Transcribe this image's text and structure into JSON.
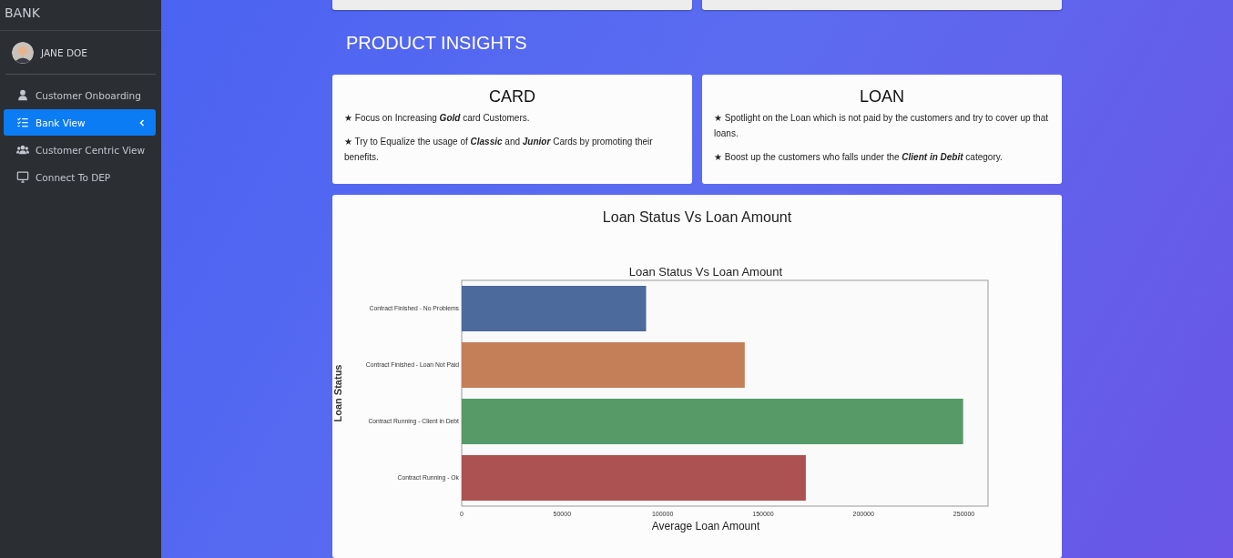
{
  "sidebar": {
    "brand": "BANK",
    "user": {
      "name": "JANE DOE"
    },
    "items": [
      {
        "label": "Customer Onboarding",
        "selected": false,
        "expandable": false
      },
      {
        "label": "Bank View",
        "selected": true,
        "expandable": true
      },
      {
        "label": "Customer Centric View",
        "selected": false,
        "expandable": false
      },
      {
        "label": "Connect To DEP",
        "selected": false,
        "expandable": false
      }
    ]
  },
  "section_title": "PRODUCT INSIGHTS",
  "insight_cards": [
    {
      "title": "CARD",
      "points": [
        "★ Focus on Increasing **Gold** card Customers.",
        "★ Try to Equalize the usage of **Classic** and **Junior** Cards by promoting their benefits."
      ]
    },
    {
      "title": "LOAN",
      "points": [
        "★ Spotlight on the Loan which is not paid by the customers and try to cover up that loans.",
        "★ Boost up the customers who falls under the **Client in Debit** category."
      ]
    }
  ],
  "chart_card": {
    "heading": "Loan Status Vs Loan Amount",
    "chart_data": {
      "type": "bar",
      "orientation": "horizontal",
      "title": "Loan Status Vs Loan Amount",
      "xlabel": "Average Loan Amount",
      "ylabel": "Loan Status",
      "categories": [
        "Contract Finished - No Problems",
        "Contract Finished - Loan Not Paid",
        "Contract Running - Client in Debt",
        "Contract Running - Ok"
      ],
      "series": [
        {
          "color": "#4c6a9c",
          "values": [
            91800,
            null,
            null,
            null
          ]
        },
        {
          "color": "#c47f58",
          "values": [
            null,
            140900,
            null,
            null
          ]
        },
        {
          "color": "#579a68",
          "values": [
            null,
            null,
            249600,
            null
          ]
        },
        {
          "color": "#ac5253",
          "values": [
            null,
            null,
            null,
            171300
          ]
        }
      ],
      "xlim": [
        0,
        262000
      ],
      "xticks": [
        0,
        50000,
        100000,
        150000,
        200000,
        250000
      ]
    }
  }
}
